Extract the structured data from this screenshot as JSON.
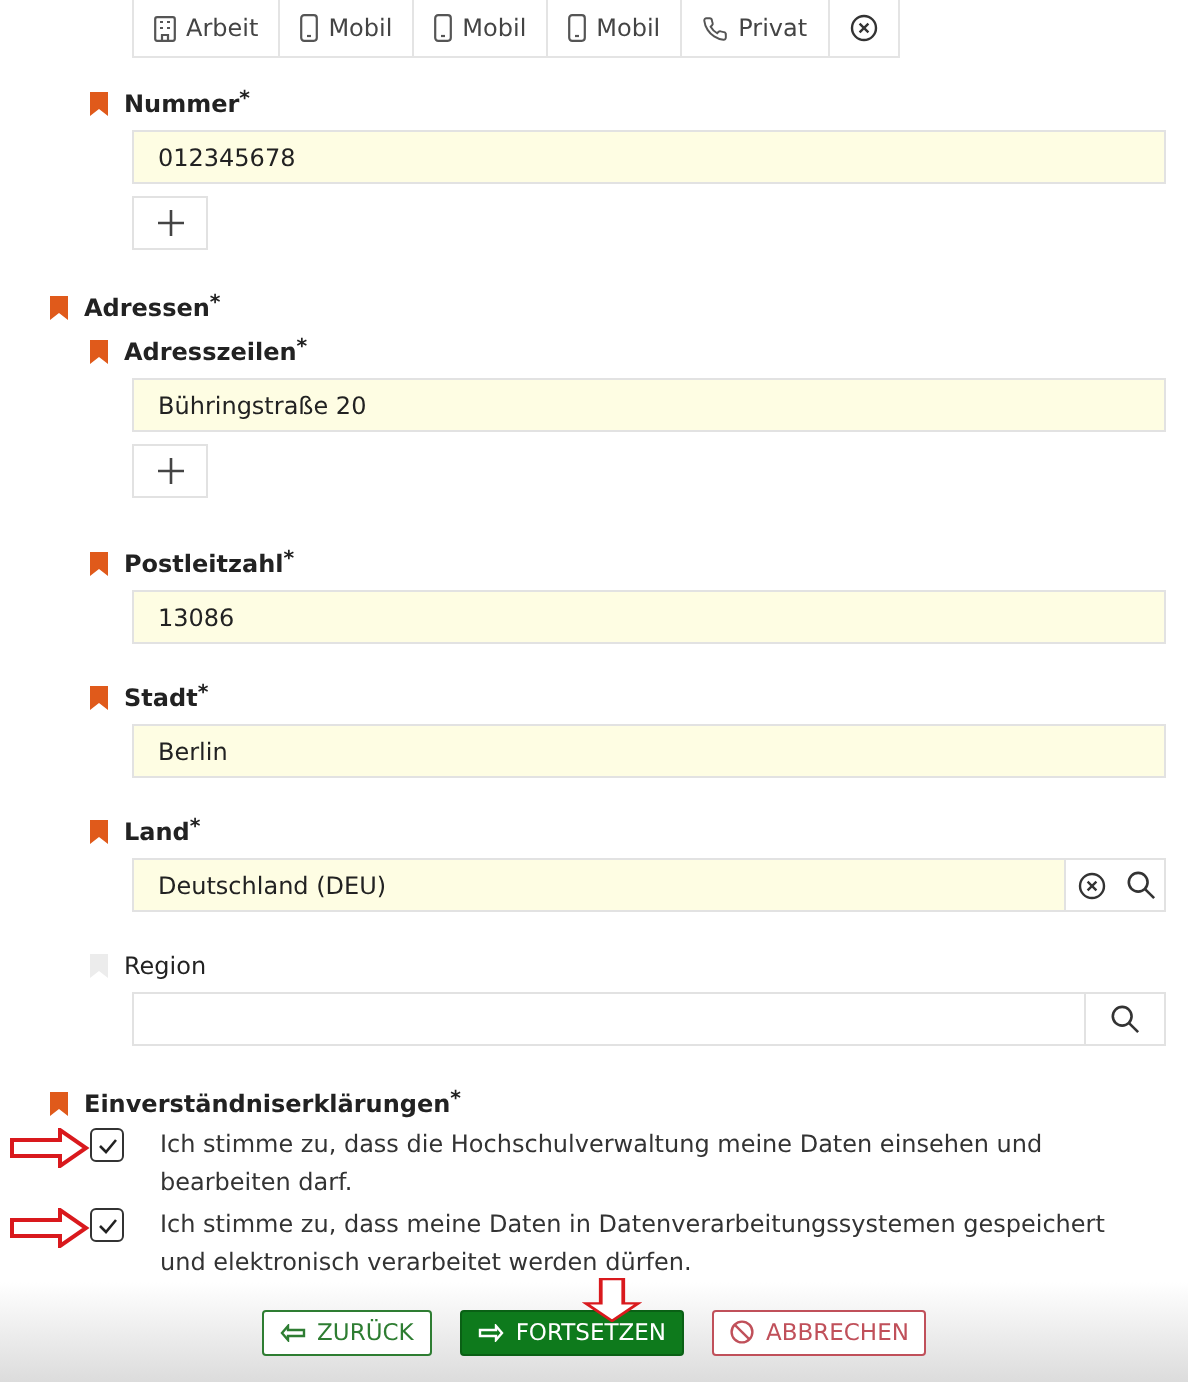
{
  "phone": {
    "types": [
      {
        "label": "Arbeit",
        "kind": "office"
      },
      {
        "label": "Mobil",
        "kind": "mobile"
      },
      {
        "label": "Mobil",
        "kind": "mobile"
      },
      {
        "label": "Mobil",
        "kind": "mobile"
      },
      {
        "label": "Privat",
        "kind": "phone"
      }
    ],
    "number": {
      "label": "Nummer$^{*}$",
      "required": true,
      "value": "012345678"
    }
  },
  "addresses": {
    "label": "Adressen$^{*}$",
    "required": true,
    "fields": [
      {
        "label": "Adresszeilen$^{*}$",
        "required": true,
        "value": "Bühringstraße 20",
        "kind": "multi"
      },
      {
        "label": "Postleitzahl$^{*}$",
        "required": true,
        "value": "13086",
        "kind": "text"
      },
      {
        "label": "Stadt$^{*}$",
        "required": true,
        "value": "Berlin",
        "kind": "text"
      },
      {
        "label": "Land$^{*}$",
        "required": true,
        "value": "Deutschland (DEU)",
        "kind": "lookup",
        "clearable": true
      },
      {
        "label": "Region",
        "required": false,
        "kind": "lookup",
        "clearable": false
      }
    ]
  },
  "consents": {
    "label": "Einverständniserklärungen$^{*}$",
    "required": true,
    "items": [
      {
        "text": "Ich stimme zu, dass die Hochschulverwaltung meine Daten einsehen und bearbeiten darf.",
        "checked": true
      },
      {
        "text": "Ich stimme zu, dass meine Daten in Datenverarbeitungssystemen gespeichert und elektronisch verarbeitet werden dürfen.",
        "checked": true
      }
    ]
  },
  "buttons": [
    {
      "label": "ZURÜCK",
      "kind": "back"
    },
    {
      "label": "FORTSETZEN",
      "kind": "next"
    },
    {
      "label": "ABBRECHEN",
      "kind": "cancel"
    }
  ]
}
